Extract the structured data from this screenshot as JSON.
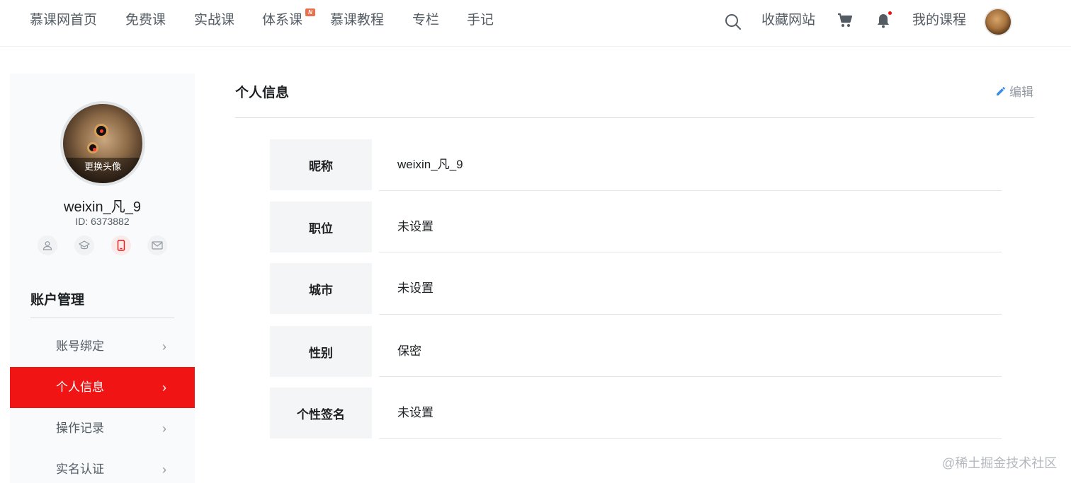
{
  "nav": {
    "items": [
      "慕课网首页",
      "免费课",
      "实战课",
      "体系课",
      "慕课教程",
      "专栏",
      "手记"
    ],
    "new_badge": "N",
    "favorites": "收藏网站",
    "my_courses": "我的课程"
  },
  "sidebar": {
    "avatar_overlay": "更换头像",
    "username": "weixin_凡_9",
    "user_id": "ID: 6373882",
    "bind_icons": [
      "user-icon",
      "graduation-cap-icon",
      "phone-icon",
      "mail-icon"
    ],
    "section_title": "账户管理",
    "menu": [
      {
        "label": "账号绑定",
        "active": false
      },
      {
        "label": "个人信息",
        "active": true
      },
      {
        "label": "操作记录",
        "active": false
      },
      {
        "label": "实名认证",
        "active": false
      }
    ]
  },
  "main": {
    "title": "个人信息",
    "edit_label": "编辑",
    "fields": [
      {
        "label": "昵称",
        "value": "weixin_凡_9"
      },
      {
        "label": "职位",
        "value": "未设置"
      },
      {
        "label": "城市",
        "value": "未设置"
      },
      {
        "label": "性别",
        "value": "保密"
      },
      {
        "label": "个性签名",
        "value": "未设置"
      }
    ]
  },
  "watermark": "@稀土掘金技术社区",
  "colors": {
    "accent": "#f01414",
    "text_primary": "#1c1f21",
    "text_secondary": "#545c63",
    "label_bg": "#f3f5f7",
    "edit_icon": "#3a8ee6"
  }
}
